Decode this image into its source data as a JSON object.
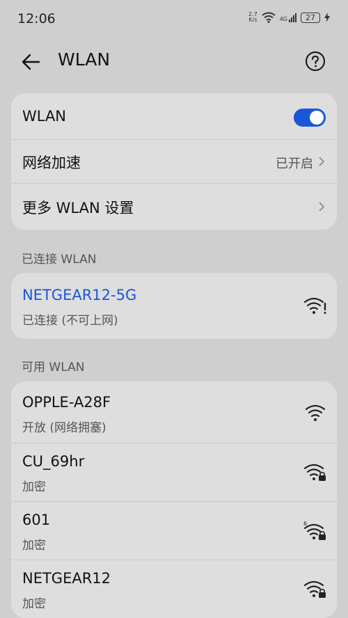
{
  "status": {
    "time": "12:06",
    "netspeed_value": "2.7",
    "netspeed_unit": "K/s",
    "signal_label": "4G",
    "battery": "27"
  },
  "header": {
    "title": "WLAN"
  },
  "settings": {
    "wlan_label": "WLAN",
    "wlan_enabled": true,
    "network_accel_label": "网络加速",
    "network_accel_value": "已开启",
    "more_settings_label": "更多 WLAN 设置"
  },
  "connected": {
    "section_label": "已连接 WLAN",
    "network": {
      "name": "NETGEAR12-5G",
      "status": "已连接 (不可上网)",
      "accent_color": "#1a56d8"
    }
  },
  "available": {
    "section_label": "可用 WLAN",
    "networks": [
      {
        "name": "OPPLE-A28F",
        "status": "开放 (网络拥塞)",
        "icon": "wifi-open-icon"
      },
      {
        "name": "CU_69hr",
        "status": "加密",
        "icon": "wifi-locked-icon"
      },
      {
        "name": "601",
        "status": "加密",
        "icon": "wifi6-locked-icon",
        "badge": "6"
      },
      {
        "name": "NETGEAR12",
        "status": "加密",
        "icon": "wifi-locked-icon"
      }
    ]
  }
}
